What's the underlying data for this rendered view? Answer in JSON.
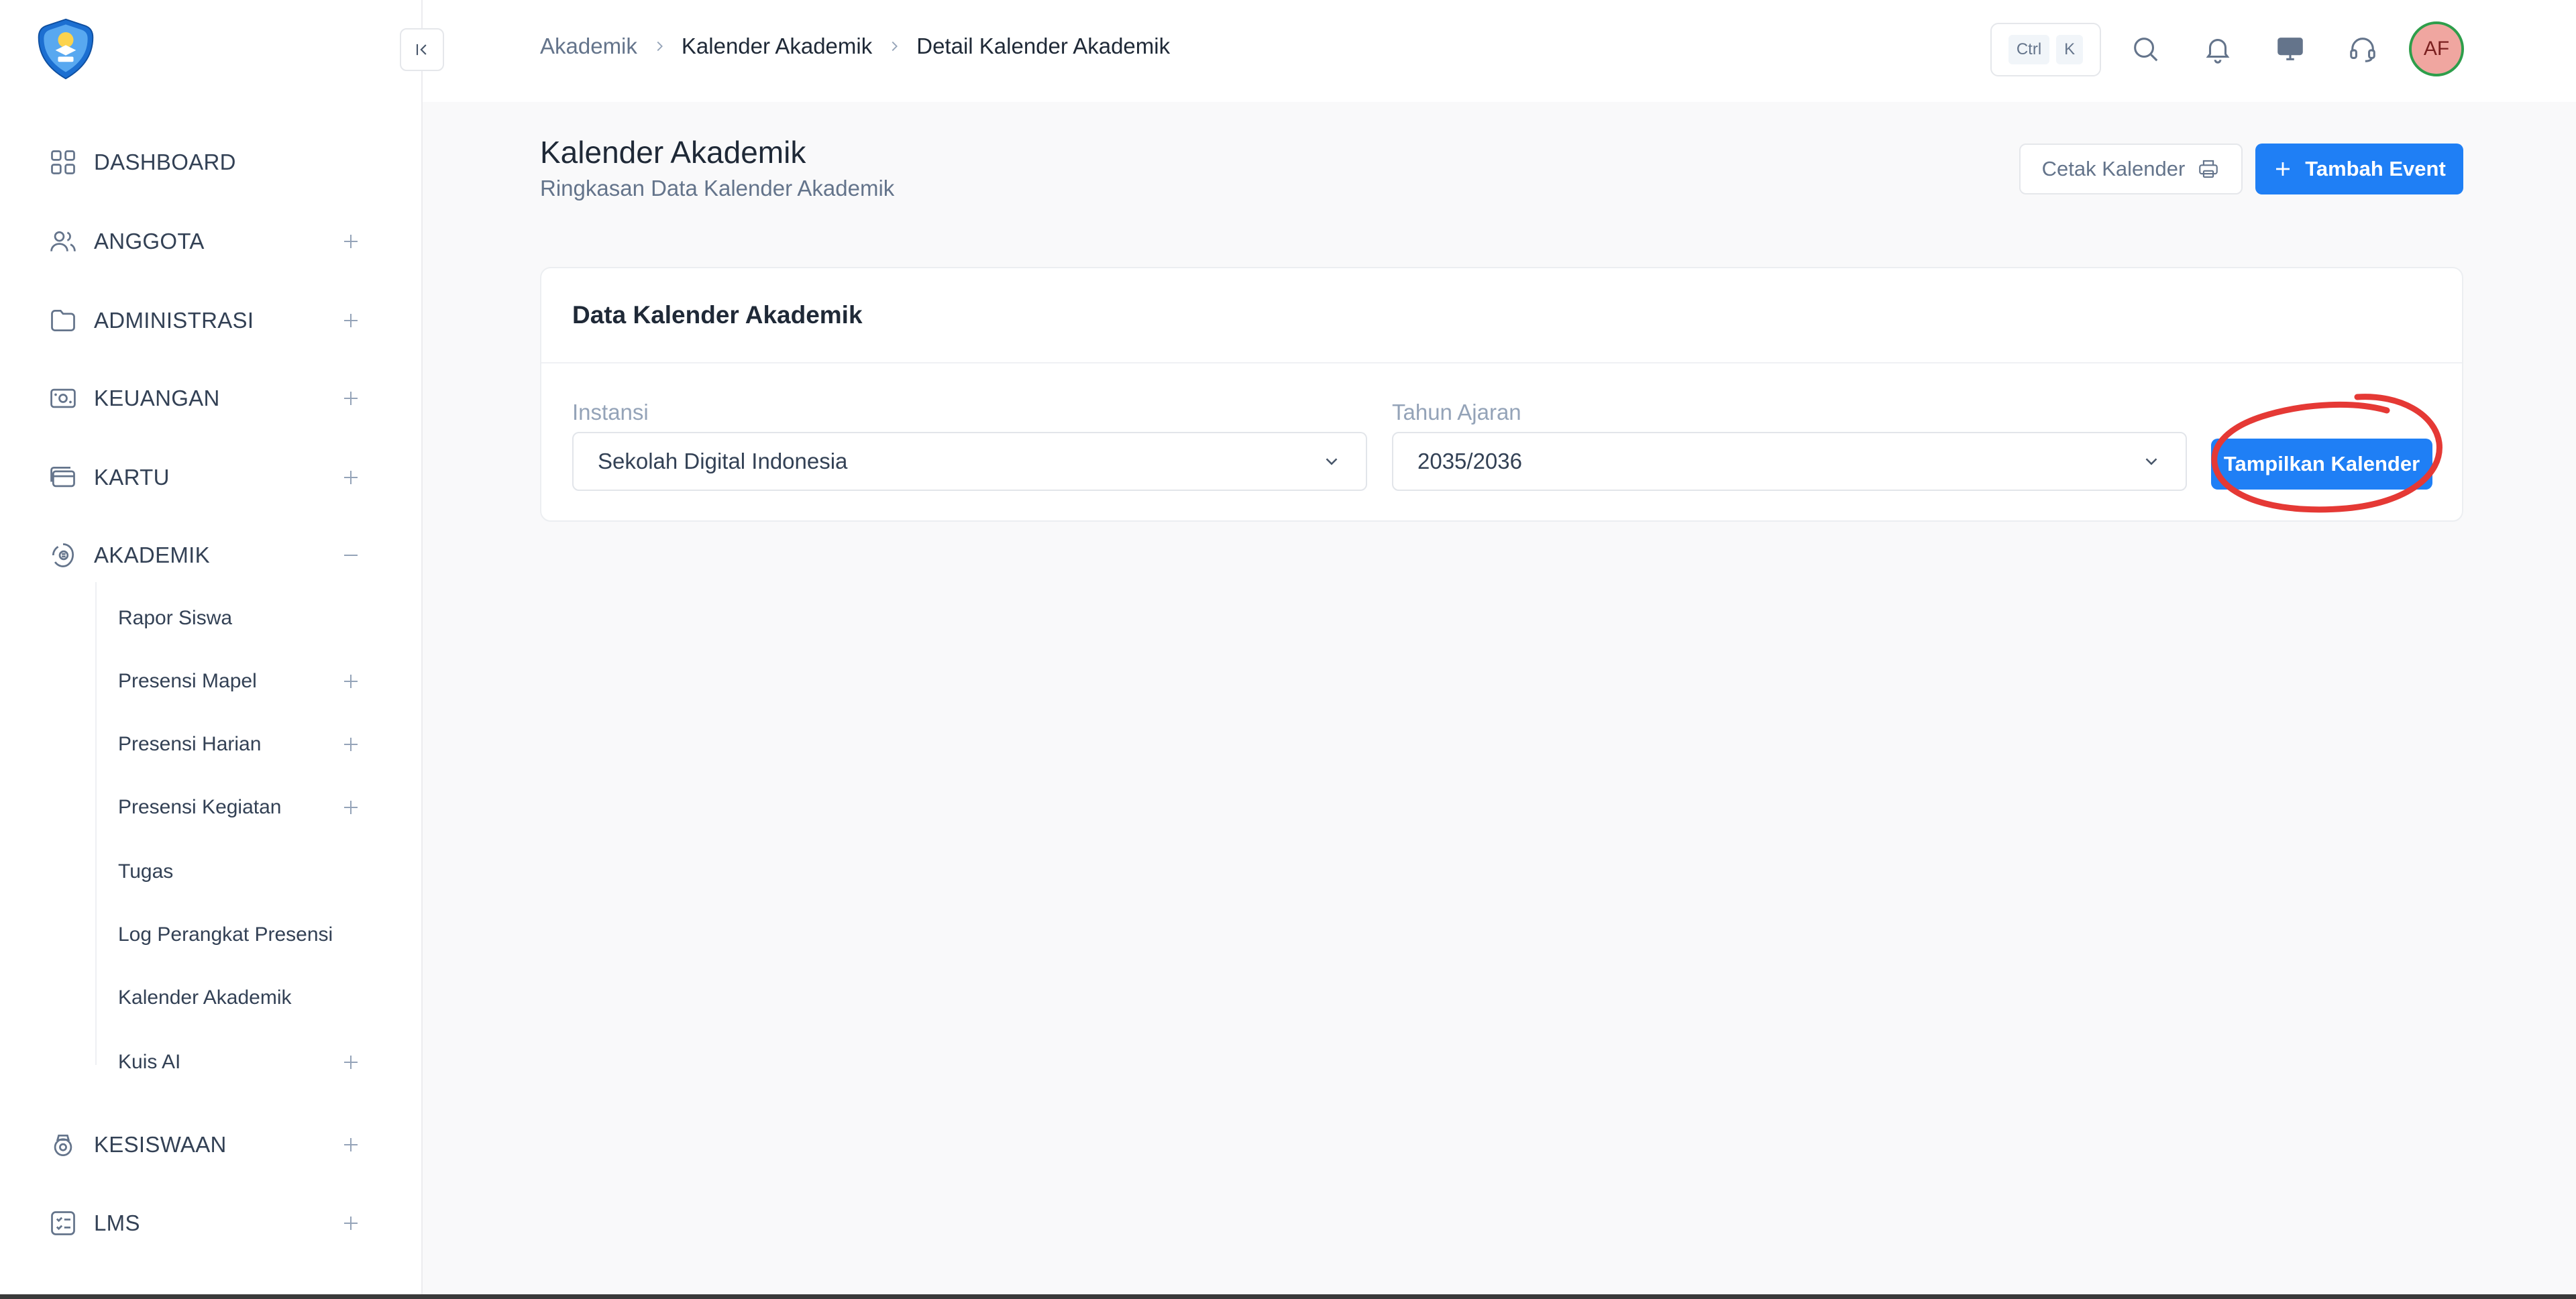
{
  "sidebar": {
    "items": [
      {
        "label": "DASHBOARD",
        "icon": "dashboard-grid-icon",
        "toggle": ""
      },
      {
        "label": "ANGGOTA",
        "icon": "users-icon",
        "toggle": "plus-icon"
      },
      {
        "label": "ADMINISTRASI",
        "icon": "folder-icon",
        "toggle": "plus-icon"
      },
      {
        "label": "KEUANGAN",
        "icon": "money-icon",
        "toggle": "plus-icon"
      },
      {
        "label": "KARTU",
        "icon": "card-icon",
        "toggle": "plus-icon"
      },
      {
        "label": "AKADEMIK",
        "icon": "academic-icon",
        "toggle": "minus-icon"
      },
      {
        "label": "KESISWAAN",
        "icon": "student-icon",
        "toggle": "plus-icon"
      },
      {
        "label": "LMS",
        "icon": "lms-list-icon",
        "toggle": "plus-icon"
      }
    ],
    "akademik_sub": [
      {
        "label": "Rapor Siswa",
        "toggle": ""
      },
      {
        "label": "Presensi Mapel",
        "toggle": "plus-icon"
      },
      {
        "label": "Presensi Harian",
        "toggle": "plus-icon"
      },
      {
        "label": "Presensi Kegiatan",
        "toggle": "plus-icon"
      },
      {
        "label": "Tugas",
        "toggle": ""
      },
      {
        "label": "Log Perangkat Presensi",
        "toggle": ""
      },
      {
        "label": "Kalender Akademik",
        "toggle": ""
      },
      {
        "label": "Kuis AI",
        "toggle": "plus-icon"
      }
    ]
  },
  "breadcrumb": {
    "items": [
      "Akademik",
      "Kalender Akademik",
      "Detail Kalender Akademik"
    ]
  },
  "topbar": {
    "kbd_ctrl": "Ctrl",
    "kbd_k": "K",
    "avatar_initials": "AF"
  },
  "page": {
    "title": "Kalender Akademik",
    "subtitle": "Ringkasan Data Kalender Akademik",
    "print_button": "Cetak Kalender",
    "add_button": "Tambah Event"
  },
  "card": {
    "title": "Data Kalender Akademik",
    "instansi_label": "Instansi",
    "instansi_value": "Sekolah Digital Indonesia",
    "tahun_label": "Tahun Ajaran",
    "tahun_value": "2035/2036",
    "show_button": "Tampilkan Kalender"
  },
  "colors": {
    "primary": "#1f7ff5",
    "annotation": "#e53935",
    "avatar_bg": "#f0a6a0",
    "avatar_ring": "#2e9e4b"
  }
}
